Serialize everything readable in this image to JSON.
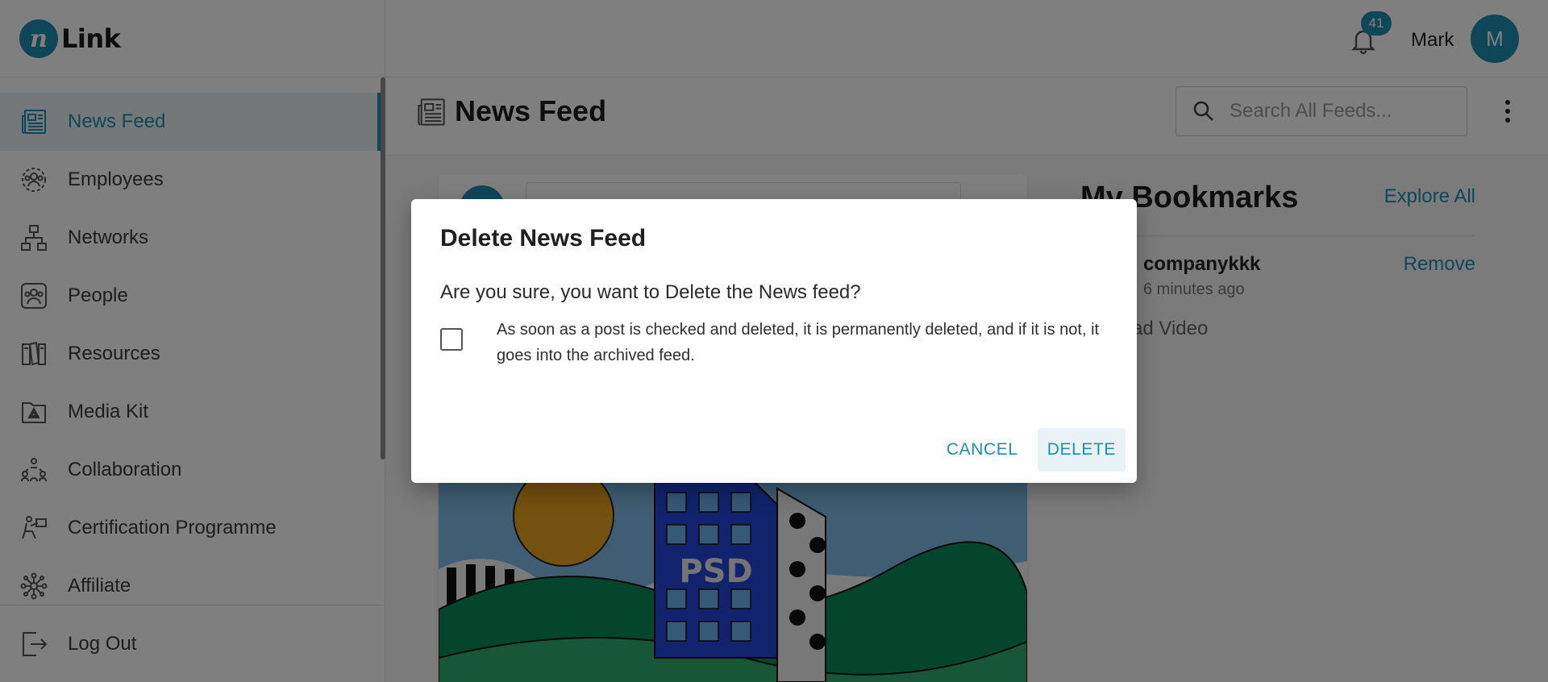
{
  "app": {
    "logo_mark": "n",
    "logo_text": "Link"
  },
  "header": {
    "notification_count": "41",
    "user_name": "Mark",
    "avatar_initial": "M"
  },
  "sidebar": {
    "items": [
      {
        "label": "News Feed",
        "icon": "news-feed-icon",
        "active": true
      },
      {
        "label": "Employees",
        "icon": "employees-icon",
        "active": false
      },
      {
        "label": "Networks",
        "icon": "networks-icon",
        "active": false
      },
      {
        "label": "People",
        "icon": "people-icon",
        "active": false
      },
      {
        "label": "Resources",
        "icon": "resources-icon",
        "active": false
      },
      {
        "label": "Media Kit",
        "icon": "media-kit-icon",
        "active": false
      },
      {
        "label": "Collaboration",
        "icon": "collaboration-icon",
        "active": false
      },
      {
        "label": "Certification Programme",
        "icon": "certification-icon",
        "active": false
      },
      {
        "label": "Affiliate",
        "icon": "affiliate-icon",
        "active": false
      }
    ],
    "logout_label": "Log Out"
  },
  "page": {
    "title": "News Feed",
    "search_placeholder": "Search All Feeds..."
  },
  "bookmarks": {
    "title": "My Bookmarks",
    "explore_label": "Explore All",
    "item": {
      "name": "companykkk",
      "time": "6 minutes ago",
      "remove_label": "Remove",
      "description": "ad Video"
    }
  },
  "post": {
    "image_text": "PSD"
  },
  "dialog": {
    "title": "Delete News Feed",
    "question": "Are you sure, you want to Delete the News feed?",
    "note": "As soon as a post is checked and deleted, it is permanently deleted, and if it is not, it goes into the archived feed.",
    "cancel_label": "CANCEL",
    "delete_label": "DELETE",
    "checkbox_checked": false
  },
  "colors": {
    "accent": "#1e8fb0",
    "overlay": "rgba(0,0,0,0.5)"
  }
}
